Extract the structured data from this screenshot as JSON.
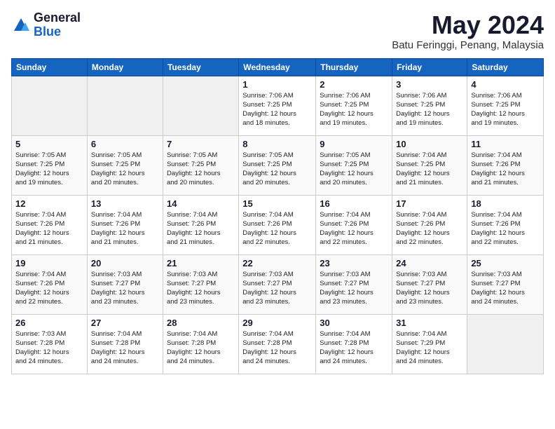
{
  "logo": {
    "general": "General",
    "blue": "Blue"
  },
  "title": {
    "month_year": "May 2024",
    "location": "Batu Feringgi, Penang, Malaysia"
  },
  "weekdays": [
    "Sunday",
    "Monday",
    "Tuesday",
    "Wednesday",
    "Thursday",
    "Friday",
    "Saturday"
  ],
  "weeks": [
    [
      {
        "day": "",
        "info": ""
      },
      {
        "day": "",
        "info": ""
      },
      {
        "day": "",
        "info": ""
      },
      {
        "day": "1",
        "info": "Sunrise: 7:06 AM\nSunset: 7:25 PM\nDaylight: 12 hours\nand 18 minutes."
      },
      {
        "day": "2",
        "info": "Sunrise: 7:06 AM\nSunset: 7:25 PM\nDaylight: 12 hours\nand 19 minutes."
      },
      {
        "day": "3",
        "info": "Sunrise: 7:06 AM\nSunset: 7:25 PM\nDaylight: 12 hours\nand 19 minutes."
      },
      {
        "day": "4",
        "info": "Sunrise: 7:06 AM\nSunset: 7:25 PM\nDaylight: 12 hours\nand 19 minutes."
      }
    ],
    [
      {
        "day": "5",
        "info": "Sunrise: 7:05 AM\nSunset: 7:25 PM\nDaylight: 12 hours\nand 19 minutes."
      },
      {
        "day": "6",
        "info": "Sunrise: 7:05 AM\nSunset: 7:25 PM\nDaylight: 12 hours\nand 20 minutes."
      },
      {
        "day": "7",
        "info": "Sunrise: 7:05 AM\nSunset: 7:25 PM\nDaylight: 12 hours\nand 20 minutes."
      },
      {
        "day": "8",
        "info": "Sunrise: 7:05 AM\nSunset: 7:25 PM\nDaylight: 12 hours\nand 20 minutes."
      },
      {
        "day": "9",
        "info": "Sunrise: 7:05 AM\nSunset: 7:25 PM\nDaylight: 12 hours\nand 20 minutes."
      },
      {
        "day": "10",
        "info": "Sunrise: 7:04 AM\nSunset: 7:25 PM\nDaylight: 12 hours\nand 21 minutes."
      },
      {
        "day": "11",
        "info": "Sunrise: 7:04 AM\nSunset: 7:26 PM\nDaylight: 12 hours\nand 21 minutes."
      }
    ],
    [
      {
        "day": "12",
        "info": "Sunrise: 7:04 AM\nSunset: 7:26 PM\nDaylight: 12 hours\nand 21 minutes."
      },
      {
        "day": "13",
        "info": "Sunrise: 7:04 AM\nSunset: 7:26 PM\nDaylight: 12 hours\nand 21 minutes."
      },
      {
        "day": "14",
        "info": "Sunrise: 7:04 AM\nSunset: 7:26 PM\nDaylight: 12 hours\nand 21 minutes."
      },
      {
        "day": "15",
        "info": "Sunrise: 7:04 AM\nSunset: 7:26 PM\nDaylight: 12 hours\nand 22 minutes."
      },
      {
        "day": "16",
        "info": "Sunrise: 7:04 AM\nSunset: 7:26 PM\nDaylight: 12 hours\nand 22 minutes."
      },
      {
        "day": "17",
        "info": "Sunrise: 7:04 AM\nSunset: 7:26 PM\nDaylight: 12 hours\nand 22 minutes."
      },
      {
        "day": "18",
        "info": "Sunrise: 7:04 AM\nSunset: 7:26 PM\nDaylight: 12 hours\nand 22 minutes."
      }
    ],
    [
      {
        "day": "19",
        "info": "Sunrise: 7:04 AM\nSunset: 7:26 PM\nDaylight: 12 hours\nand 22 minutes."
      },
      {
        "day": "20",
        "info": "Sunrise: 7:03 AM\nSunset: 7:27 PM\nDaylight: 12 hours\nand 23 minutes."
      },
      {
        "day": "21",
        "info": "Sunrise: 7:03 AM\nSunset: 7:27 PM\nDaylight: 12 hours\nand 23 minutes."
      },
      {
        "day": "22",
        "info": "Sunrise: 7:03 AM\nSunset: 7:27 PM\nDaylight: 12 hours\nand 23 minutes."
      },
      {
        "day": "23",
        "info": "Sunrise: 7:03 AM\nSunset: 7:27 PM\nDaylight: 12 hours\nand 23 minutes."
      },
      {
        "day": "24",
        "info": "Sunrise: 7:03 AM\nSunset: 7:27 PM\nDaylight: 12 hours\nand 23 minutes."
      },
      {
        "day": "25",
        "info": "Sunrise: 7:03 AM\nSunset: 7:27 PM\nDaylight: 12 hours\nand 24 minutes."
      }
    ],
    [
      {
        "day": "26",
        "info": "Sunrise: 7:03 AM\nSunset: 7:28 PM\nDaylight: 12 hours\nand 24 minutes."
      },
      {
        "day": "27",
        "info": "Sunrise: 7:04 AM\nSunset: 7:28 PM\nDaylight: 12 hours\nand 24 minutes."
      },
      {
        "day": "28",
        "info": "Sunrise: 7:04 AM\nSunset: 7:28 PM\nDaylight: 12 hours\nand 24 minutes."
      },
      {
        "day": "29",
        "info": "Sunrise: 7:04 AM\nSunset: 7:28 PM\nDaylight: 12 hours\nand 24 minutes."
      },
      {
        "day": "30",
        "info": "Sunrise: 7:04 AM\nSunset: 7:28 PM\nDaylight: 12 hours\nand 24 minutes."
      },
      {
        "day": "31",
        "info": "Sunrise: 7:04 AM\nSunset: 7:29 PM\nDaylight: 12 hours\nand 24 minutes."
      },
      {
        "day": "",
        "info": ""
      }
    ]
  ]
}
